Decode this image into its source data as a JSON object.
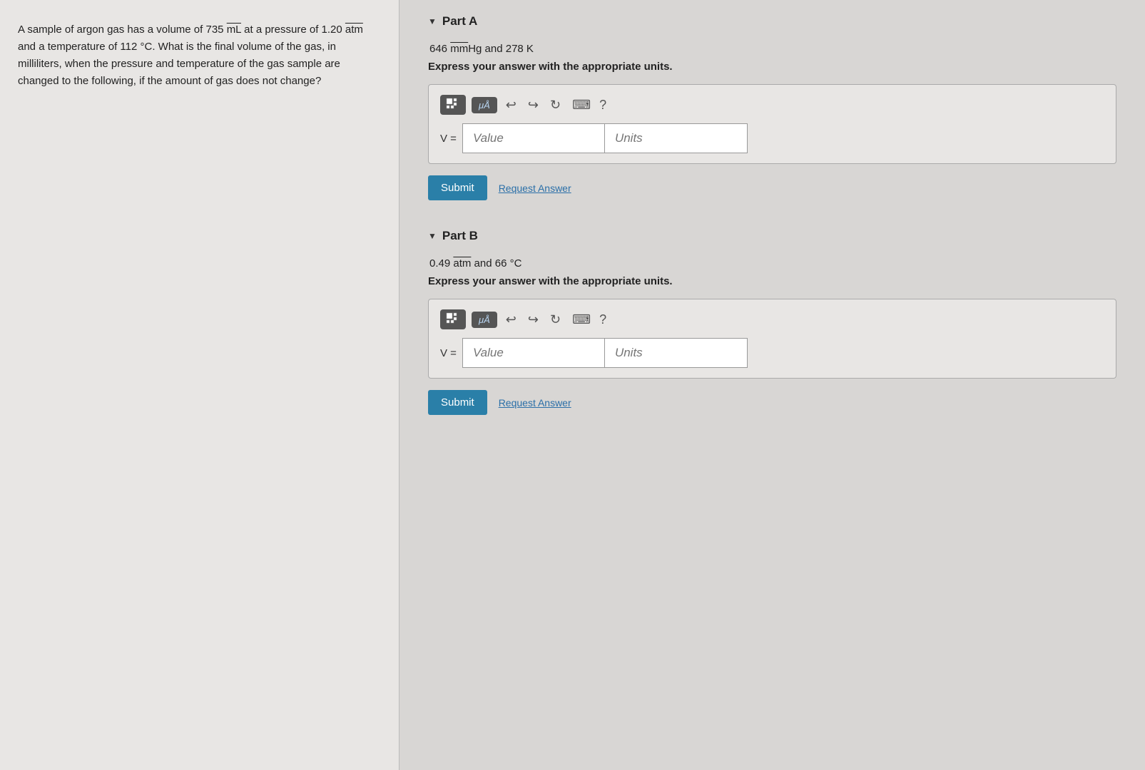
{
  "left_panel": {
    "problem_text": "A sample of argon gas has a volume of 735 mL at a pressure of 1.20 atm and a temperature of 112 °C. What is the final volume of the gas, in milliliters, when the pressure and temperature of the gas sample are changed to the following, if the amount of gas does not change?"
  },
  "right_panel": {
    "part_a": {
      "label": "Part A",
      "condition": "646 mmHg and 278 K",
      "instruction": "Express your answer with the appropriate units.",
      "toolbar": {
        "grid_icon": "grid-icon",
        "mu_label": "μÅ",
        "undo_icon": "↩",
        "redo_icon": "↪",
        "refresh_icon": "↻",
        "keyboard_icon": "⌨",
        "help_icon": "?"
      },
      "input": {
        "v_label": "V =",
        "value_placeholder": "Value",
        "units_placeholder": "Units"
      },
      "submit_label": "Submit",
      "request_answer_label": "Request Answer"
    },
    "part_b": {
      "label": "Part B",
      "condition": "0.49 atm and 66 °C",
      "instruction": "Express your answer with the appropriate units.",
      "toolbar": {
        "grid_icon": "grid-icon",
        "mu_label": "μÅ",
        "undo_icon": "↩",
        "redo_icon": "↪",
        "refresh_icon": "↻",
        "keyboard_icon": "⌨",
        "help_icon": "?"
      },
      "input": {
        "v_label": "V =",
        "value_placeholder": "Value",
        "units_placeholder": "Units"
      },
      "submit_label": "Submit",
      "request_answer_label": "Request Answer"
    }
  }
}
